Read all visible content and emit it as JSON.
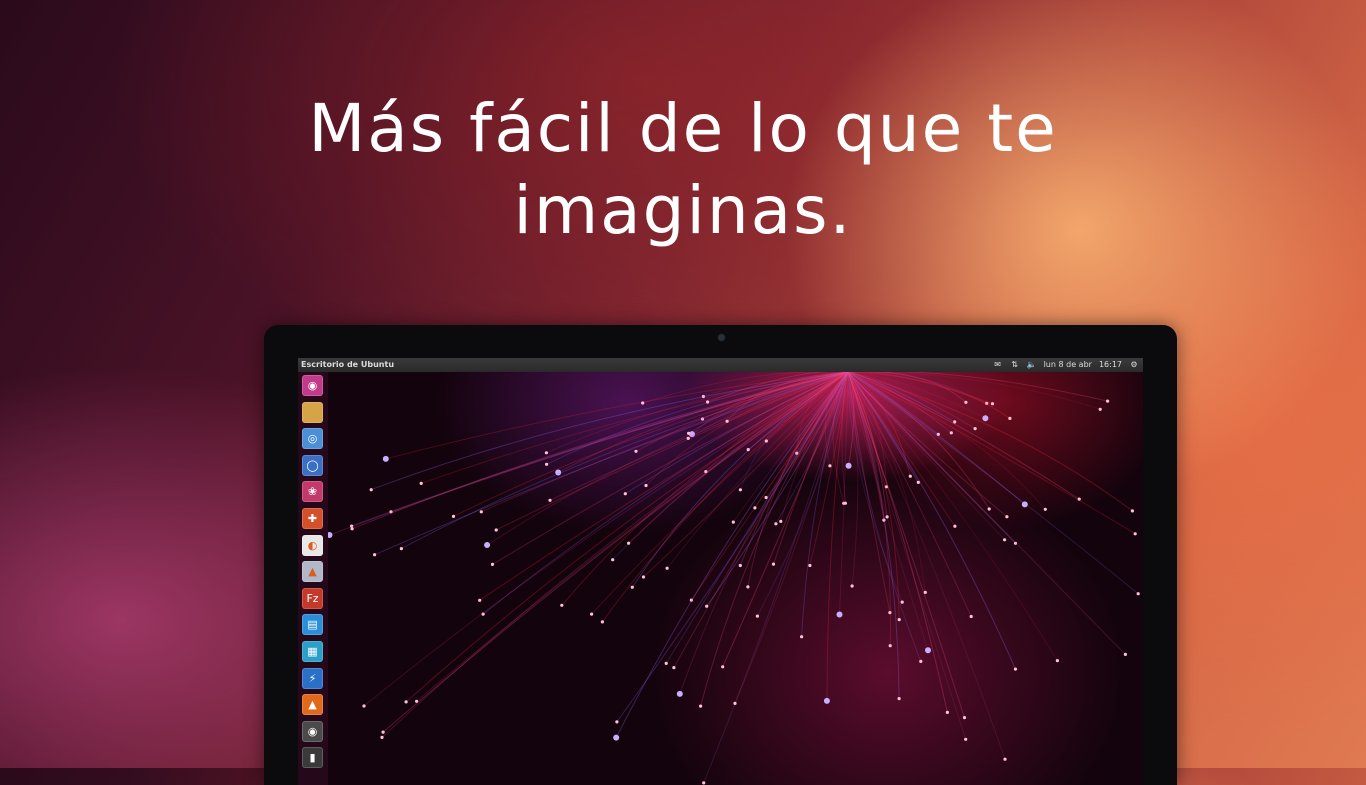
{
  "headline": {
    "line1": "Más fácil de lo que te",
    "line2": "imaginas."
  },
  "desktop": {
    "window_title": "Escritorio de Ubuntu",
    "indicators": {
      "mail_icon": "envelope-icon",
      "network_icon": "network-arrows-icon",
      "volume_icon": "speaker-icon",
      "date": "lun  8 de abr",
      "time": "16:17",
      "session_icon": "gear-icon"
    },
    "launcher": [
      {
        "name": "dash-home",
        "glyph": "◉",
        "color": "#c23a8a"
      },
      {
        "name": "files",
        "glyph": "",
        "color": "#d6a347"
      },
      {
        "name": "browser",
        "glyph": "◎",
        "color": "#4a8fd8"
      },
      {
        "name": "thunderbird",
        "glyph": "◯",
        "color": "#3a6fc4"
      },
      {
        "name": "shotwell",
        "glyph": "❀",
        "color": "#c23a6a"
      },
      {
        "name": "ubuntu-software",
        "glyph": "✚",
        "color": "#d4502a"
      },
      {
        "name": "blender",
        "glyph": "◐",
        "color": "#e8e8e8"
      },
      {
        "name": "image-viewer",
        "glyph": "▲",
        "color": "#b0b8c8"
      },
      {
        "name": "filezilla",
        "glyph": "Fz",
        "color": "#c43a2a"
      },
      {
        "name": "libreoffice-writer",
        "glyph": "▤",
        "color": "#2a8fd8"
      },
      {
        "name": "libreoffice-calc",
        "glyph": "▦",
        "color": "#2aa0c8"
      },
      {
        "name": "power-tool",
        "glyph": "⚡",
        "color": "#2a6fc8"
      },
      {
        "name": "vlc",
        "glyph": "▲",
        "color": "#e06a1a"
      },
      {
        "name": "disk-utility",
        "glyph": "◉",
        "color": "#4a4a4a"
      },
      {
        "name": "terminal",
        "glyph": "▮",
        "color": "#3a3a3a"
      }
    ]
  },
  "colors": {
    "accent": "#e07a52",
    "screen_panel": "#2e2e2e"
  }
}
